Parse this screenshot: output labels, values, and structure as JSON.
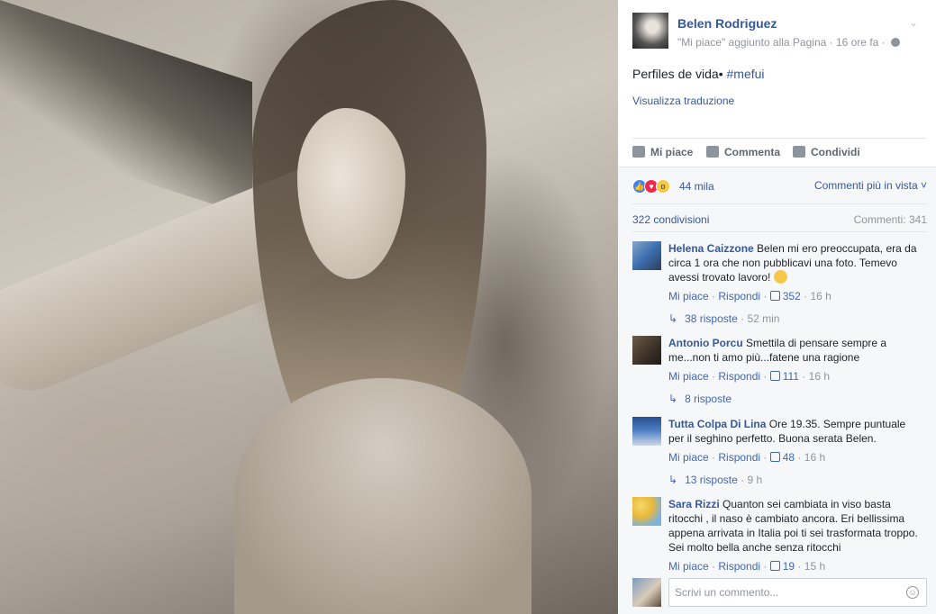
{
  "post": {
    "author": "Belen Rodriguez",
    "meta": "\"Mi piace\" aggiunto alla Pagina · 16 ore fa ·",
    "text": "Perfiles de vida•",
    "hashtag": "#mefui",
    "translate": "Visualizza traduzione"
  },
  "actions": {
    "like": "Mi piace",
    "comment": "Commenta",
    "share": "Condividi"
  },
  "stats": {
    "reactions_count": "44 mila",
    "sort_label": "Commenti più in vista ˅",
    "shares": "322 condivisioni",
    "comments": "Commenti: 341"
  },
  "comments": [
    {
      "name": "Helena Caizzone",
      "text": "Belen mi ero preoccupata, era da circa 1 ora che non pubblicavi una foto. Temevo avessi trovato lavoro!",
      "like": "Mi piace",
      "reply": "Rispondi",
      "likes": "352",
      "time": "16 h",
      "replies": "38 risposte",
      "replies_time": "52 min"
    },
    {
      "name": "Antonio Porcu",
      "text": "Smettila di pensare sempre a me...non ti amo più...fatene una ragione",
      "like": "Mi piace",
      "reply": "Rispondi",
      "likes": "111",
      "time": "16 h",
      "replies": "8 risposte",
      "replies_time": ""
    },
    {
      "name": "Tutta Colpa Di Lina",
      "text": "Ore 19.35. Sempre puntuale per il seghino perfetto. Buona serata Belen.",
      "like": "Mi piace",
      "reply": "Rispondi",
      "likes": "48",
      "time": "16 h",
      "replies": "13 risposte",
      "replies_time": "9 h"
    },
    {
      "name": "Sara Rizzi",
      "text": "Quanton sei cambiata in viso basta ritocchi , il naso è cambiato ancora. Eri bellissima appena arrivata in Italia poi ti sei trasformata troppo. Sei molto bella anche senza ritocchi",
      "like": "Mi piace",
      "reply": "Rispondi",
      "likes": "19",
      "time": "15 h"
    }
  ],
  "composer": {
    "placeholder": "Scrivi un commento..."
  },
  "icons": {
    "globe": "globe-icon",
    "chevron": "chevron-down-icon",
    "like": "thumbs-up-icon",
    "comment": "speech-bubble-icon",
    "share": "share-arrow-icon",
    "reply_arrow": "reply-arrow-icon",
    "emoji": "smiley-icon"
  },
  "colors": {
    "link": "#365899",
    "meta": "#90949c",
    "panel_bg": "#f6f7f9",
    "like_reaction": "#3b83f6",
    "love_reaction": "#f0284a",
    "wow_reaction": "#f7c848"
  }
}
